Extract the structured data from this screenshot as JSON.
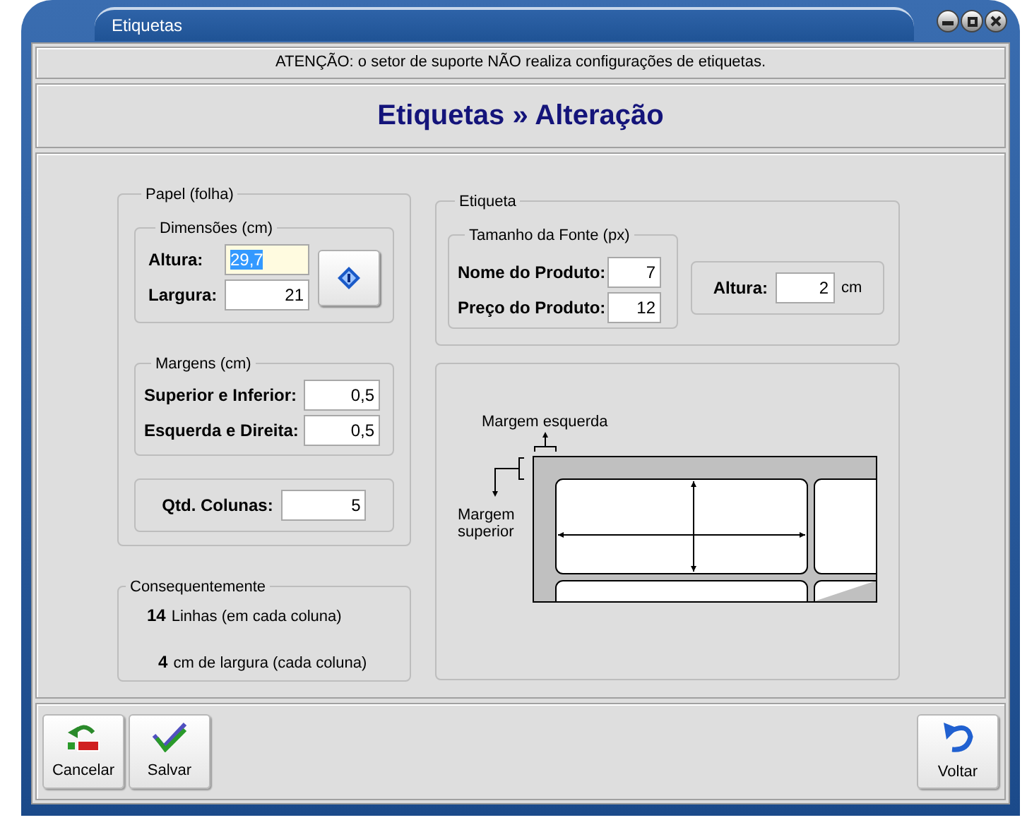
{
  "window": {
    "title": "Etiquetas"
  },
  "notice": "ATENÇÃO: o setor de suporte NÃO realiza configurações de etiquetas.",
  "heading": "Etiquetas » Alteração",
  "paper": {
    "legend": "Papel (folha)",
    "dimensions": {
      "legend": "Dimensões (cm)",
      "fields": [
        {
          "label": "Altura:",
          "value": "29,7",
          "focused": true
        },
        {
          "label": "Largura:",
          "value": "21",
          "focused": false
        }
      ]
    },
    "margins": {
      "legend": "Margens (cm)",
      "fields": [
        {
          "label": "Superior e Inferior:",
          "value": "0,5",
          "focused": false
        },
        {
          "label": "Esquerda e Direita:",
          "value": "0,5",
          "focused": false
        }
      ]
    },
    "columns": {
      "label": "Qtd. Colunas:",
      "value": "5",
      "focused": false
    }
  },
  "result": {
    "legend": "Consequentemente",
    "lines": [
      {
        "number": "14",
        "text": "Linhas (em cada coluna)"
      },
      {
        "number": "4",
        "text": "cm de largura (cada coluna)"
      }
    ]
  },
  "label": {
    "legend": "Etiqueta",
    "font_size": {
      "legend": "Tamanho da Fonte (px)",
      "fields": [
        {
          "label": "Nome do Produto:",
          "value": "7",
          "focused": false
        },
        {
          "label": "Preço do Produto:",
          "value": "12",
          "focused": false
        }
      ]
    },
    "height": {
      "label": "Altura:",
      "value": "2",
      "unit": "cm",
      "focused": false
    }
  },
  "diagram": {
    "left_margin": "Margem esquerda",
    "top_margin": "Margem superior"
  },
  "buttons": [
    {
      "label": "Cancelar",
      "kind": "cancel"
    },
    {
      "label": "Salvar",
      "kind": "save"
    },
    {
      "label": "Voltar",
      "kind": "back"
    }
  ]
}
